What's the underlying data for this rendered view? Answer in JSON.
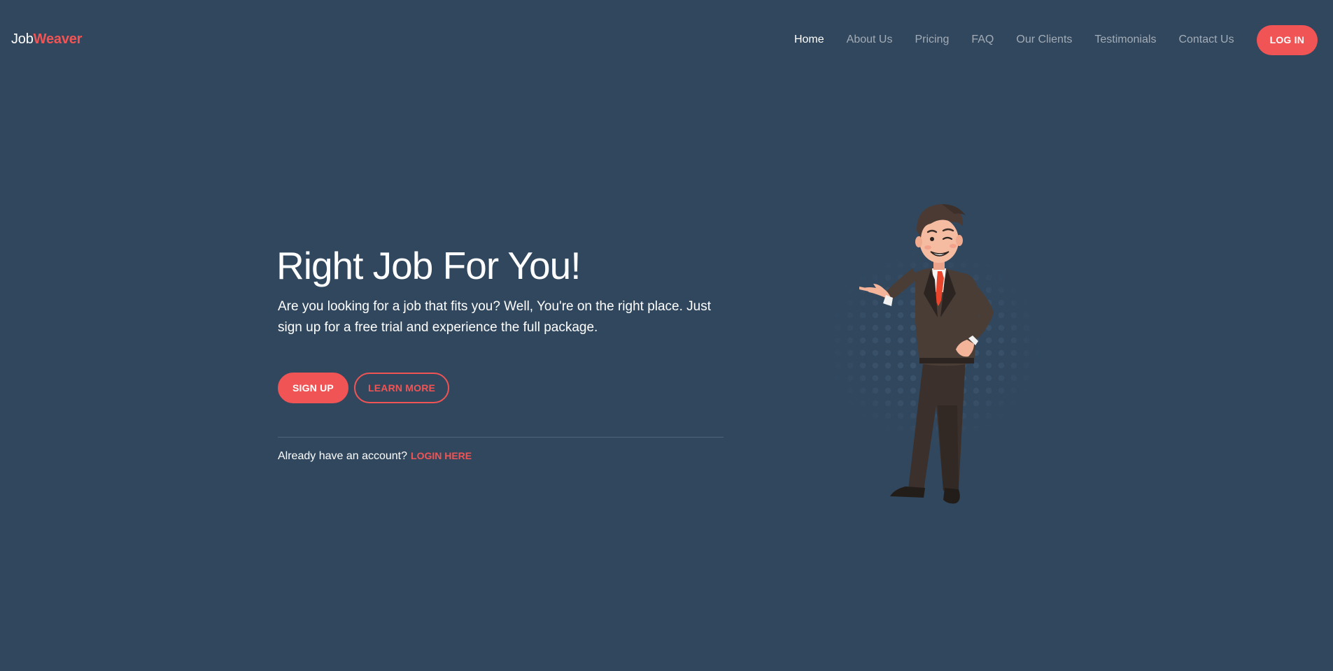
{
  "brand": {
    "prefix": "Job",
    "accent": "Weaver"
  },
  "nav": {
    "links": [
      {
        "label": "Home",
        "active": true
      },
      {
        "label": "About Us"
      },
      {
        "label": "Pricing"
      },
      {
        "label": "FAQ"
      },
      {
        "label": "Our Clients"
      },
      {
        "label": "Testimonials"
      },
      {
        "label": "Contact Us"
      }
    ],
    "login_button": "LOG IN"
  },
  "hero": {
    "title": "Right Job For You!",
    "subtitle": "Are you looking for a job that fits you? Well, You're on the right place. Just sign up for a free trial and experience the full package.",
    "signup_button": "SIGN UP",
    "learn_more_button": "LEARN MORE",
    "account_prompt": "Already have an account?",
    "login_link": "LOGIN HERE"
  },
  "illustration": {
    "icon": "businessman-pointing-illustration"
  },
  "colors": {
    "background": "#30475e",
    "accent": "#f05454",
    "text": "#ffffff",
    "nav_muted": "#a3acb6"
  }
}
